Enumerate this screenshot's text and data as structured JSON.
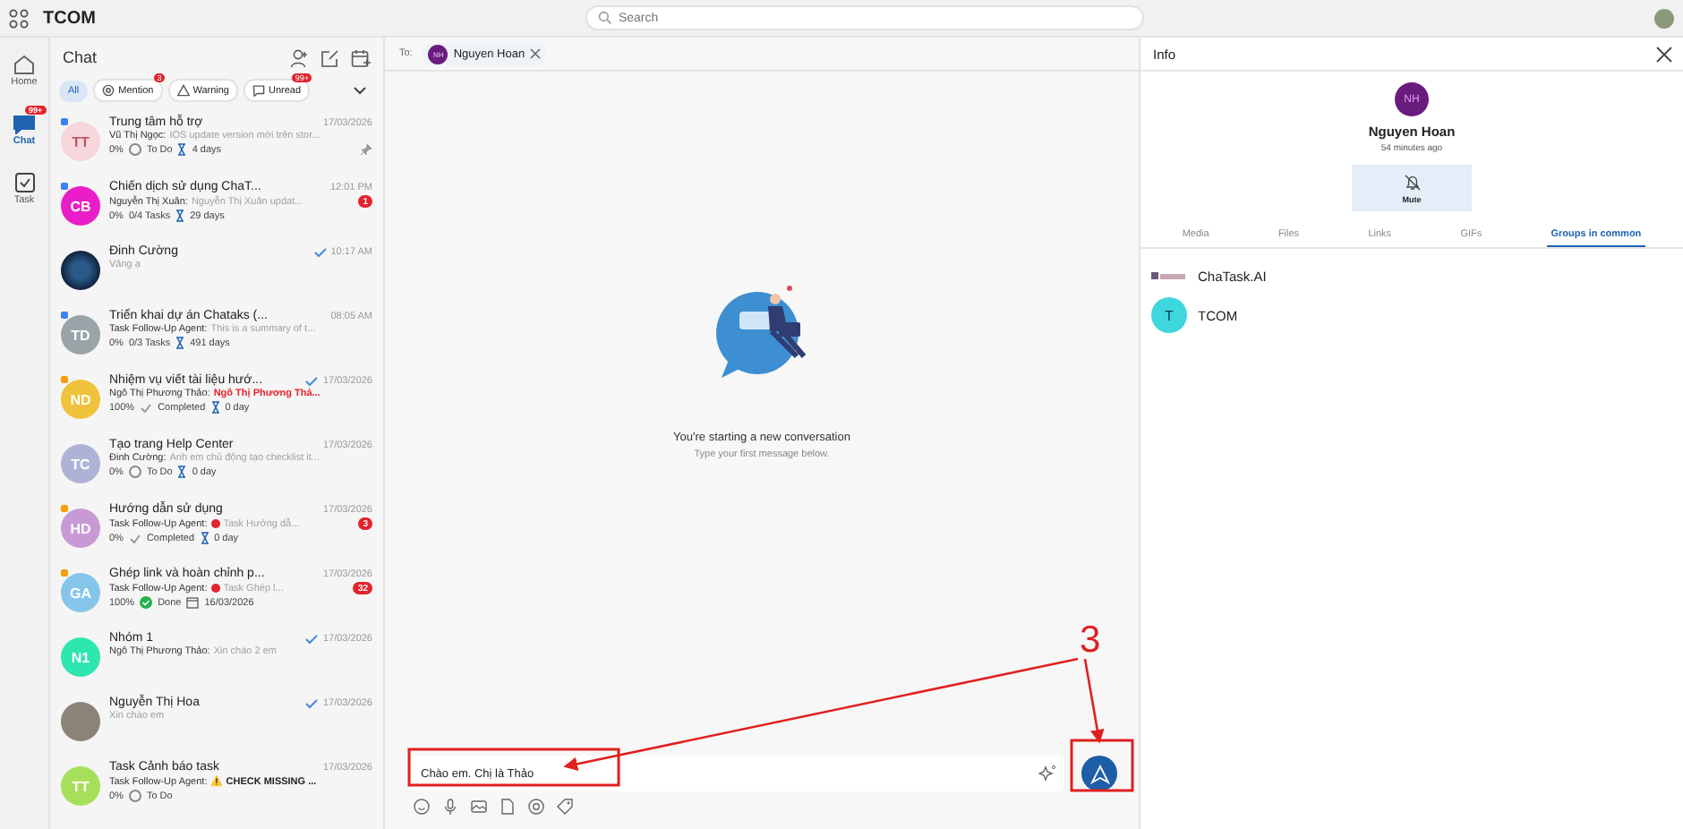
{
  "app": {
    "name": "TCOM",
    "search": {
      "placeholder": "Search"
    }
  },
  "rail": [
    {
      "label": "Home",
      "kind": "home",
      "selected": false
    },
    {
      "label": "Chat",
      "kind": "chat",
      "selected": true,
      "badge": "99+"
    },
    {
      "label": "Task",
      "kind": "task",
      "selected": false
    }
  ],
  "chat_list": {
    "title": "Chat",
    "filters": [
      {
        "label": "All",
        "kind": "plain",
        "selected": true
      },
      {
        "label": "Mention",
        "kind": "mention",
        "selected": false,
        "badge": "3"
      },
      {
        "label": "Warning",
        "kind": "warning",
        "selected": false
      },
      {
        "label": "Unread",
        "kind": "unread",
        "selected": false,
        "badge": "99+"
      }
    ],
    "rows": [
      {
        "avatar": {
          "kind": "initials",
          "text": "TT",
          "color": "#f7d7dc"
        },
        "flag": {
          "color": "#3b82f6"
        },
        "title": "Trung tâm hỗ trợ",
        "time": "17/03/2026",
        "tick": false,
        "sender": "Vũ Thị Ngọc:",
        "preview": {
          "kind": "plain",
          "text": "IOS update version mới trên stor..."
        },
        "pinned": true,
        "meta": {
          "progress": "0%",
          "status": {
            "kind": "todo",
            "text": "To Do"
          },
          "due": {
            "kind": "hourglass",
            "text": "4 days"
          }
        }
      },
      {
        "avatar": {
          "kind": "initials",
          "text": "CB",
          "color": "#e91ec8"
        },
        "flag": {
          "color": "#3b82f6"
        },
        "title": "Chiến dịch sử dụng ChaT...",
        "time": "12:01 PM",
        "tick": false,
        "sender": "Nguyễn Thị Xuân:",
        "preview": {
          "kind": "plain",
          "text": "Nguyễn Thị Xuân updat..."
        },
        "unread": "1",
        "meta": {
          "progress": "0%",
          "status": {
            "kind": "count",
            "text": "0/4 Tasks"
          },
          "due": {
            "kind": "hourglass",
            "text": "29 days"
          }
        }
      },
      {
        "avatar": {
          "kind": "logo"
        },
        "title": "Đinh Cường",
        "time": "10:17 AM",
        "tick": true,
        "preview": {
          "kind": "plain",
          "text": "Vâng ạ"
        }
      },
      {
        "avatar": {
          "kind": "initials",
          "text": "TD",
          "color": "#9aa3a8"
        },
        "flag": {
          "color": "#3b82f6"
        },
        "title": "Triển khai dự án Chataks (...",
        "time": "08:05 AM",
        "tick": false,
        "sender": "Task Follow-Up Agent:",
        "preview": {
          "kind": "plain",
          "text": "This is a summary of t..."
        },
        "meta": {
          "progress": "0%",
          "status": {
            "kind": "count",
            "text": "0/3 Tasks"
          },
          "due": {
            "kind": "hourglass",
            "text": "491 days"
          }
        }
      },
      {
        "avatar": {
          "kind": "initials",
          "text": "ND",
          "color": "#efc23b"
        },
        "flag": {
          "color": "#f59e0b"
        },
        "title": "Nhiệm vụ viết tài liệu hướ...",
        "time": "17/03/2026",
        "tick": true,
        "sender": "Ngô Thị Phương Thảo:",
        "preview": {
          "kind": "alert",
          "text": "Ngô Thị Phương Thả..."
        },
        "meta": {
          "progress": "100%",
          "status": {
            "kind": "completed",
            "text": "Completed"
          },
          "due": {
            "kind": "hourglass",
            "text": "0 day"
          }
        }
      },
      {
        "avatar": {
          "kind": "initials",
          "text": "TC",
          "color": "#aeb3d6"
        },
        "title": "Tạo trang Help Center",
        "time": "17/03/2026",
        "tick": false,
        "sender": "Đinh Cường:",
        "preview": {
          "kind": "plain",
          "text": "Anh em chủ động tạo checklist it..."
        },
        "meta": {
          "progress": "0%",
          "status": {
            "kind": "todo",
            "text": "To Do"
          },
          "due": {
            "kind": "hourglass",
            "text": "0 day"
          }
        }
      },
      {
        "avatar": {
          "kind": "initials",
          "text": "HD",
          "color": "#c79ad6"
        },
        "flag": {
          "color": "#f59e0b"
        },
        "title": "Hướng dẫn sử dụng",
        "time": "17/03/2026",
        "tick": false,
        "sender": "Task Follow-Up Agent:",
        "preview": {
          "kind": "dot",
          "text": "Task Hướng dẫ..."
        },
        "unread": "3",
        "meta": {
          "progress": "0%",
          "status": {
            "kind": "completed",
            "text": "Completed"
          },
          "due": {
            "kind": "hourglass",
            "text": "0 day"
          }
        }
      },
      {
        "avatar": {
          "kind": "initials",
          "text": "GA",
          "color": "#86c5ea"
        },
        "flag": {
          "color": "#f59e0b"
        },
        "title": "Ghép link và hoàn chỉnh p...",
        "time": "17/03/2026",
        "tick": false,
        "sender": "Task Follow-Up Agent:",
        "preview": {
          "kind": "dot",
          "text": "Task Ghép l..."
        },
        "unread": "32",
        "meta": {
          "progress": "100%",
          "status": {
            "kind": "done",
            "text": "Done"
          },
          "due": {
            "kind": "calendar",
            "text": "16/03/2026"
          }
        }
      },
      {
        "avatar": {
          "kind": "initials",
          "text": "N1",
          "color": "#2ee6b0"
        },
        "title": "Nhóm 1",
        "time": "17/03/2026",
        "tick": true,
        "sender": "Ngô Thị Phương Thảo:",
        "preview": {
          "kind": "plain",
          "text": "Xin chào 2 em"
        }
      },
      {
        "avatar": {
          "kind": "photo"
        },
        "title": "Nguyễn Thị Hoa",
        "time": "17/03/2026",
        "tick": true,
        "preview": {
          "kind": "plain",
          "text": "Xin chào em"
        }
      },
      {
        "avatar": {
          "kind": "initials",
          "text": "TT",
          "color": "#a6e05a"
        },
        "title": "Task Cảnh báo task",
        "time": "17/03/2026",
        "tick": false,
        "sender": "Task Follow-Up Agent:",
        "preview": {
          "kind": "bold",
          "text": "⚠️ CHECK MISSING ..."
        },
        "meta": {
          "progress": "0%",
          "status": {
            "kind": "todo",
            "text": "To Do"
          }
        }
      }
    ]
  },
  "conversation": {
    "to_label": "To:",
    "recipient": {
      "initials": "NH",
      "name": "Nguyen Hoan"
    },
    "empty_title": "You're starting a new conversation",
    "empty_hint": "Type your first message below.",
    "composer": {
      "value": "Chào em. Chị là Thảo"
    }
  },
  "info": {
    "title": "Info",
    "avatar": "NH",
    "name": "Nguyen Hoan",
    "last_seen": "54 minutes ago",
    "mute_label": "Mute",
    "tabs": [
      {
        "label": "Media",
        "selected": false
      },
      {
        "label": "Files",
        "selected": false
      },
      {
        "label": "Links",
        "selected": false
      },
      {
        "label": "GIFs",
        "selected": false
      },
      {
        "label": "Groups in common",
        "selected": true
      }
    ],
    "groups": [
      {
        "kind": "logo",
        "name": "ChaTask.AI"
      },
      {
        "kind": "initial",
        "initial": "T",
        "name": "TCOM"
      }
    ]
  },
  "annotation": {
    "label": "3"
  }
}
